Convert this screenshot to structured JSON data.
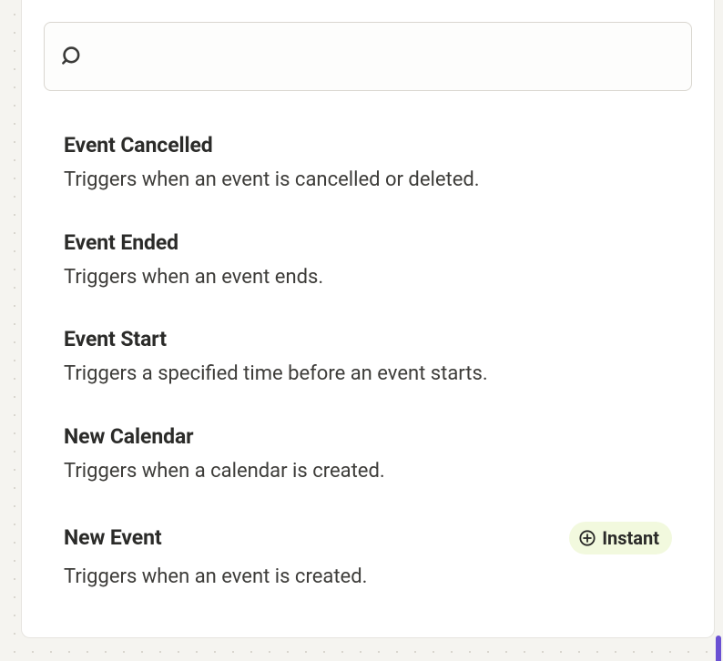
{
  "search": {
    "placeholder": ""
  },
  "badge_label": "Instant",
  "triggers": [
    {
      "title": "Event Cancelled",
      "desc": "Triggers when an event is cancelled or deleted.",
      "instant": false
    },
    {
      "title": "Event Ended",
      "desc": "Triggers when an event ends.",
      "instant": false
    },
    {
      "title": "Event Start",
      "desc": "Triggers a specified time before an event starts.",
      "instant": false
    },
    {
      "title": "New Calendar",
      "desc": "Triggers when a calendar is created.",
      "instant": false
    },
    {
      "title": "New Event",
      "desc": "Triggers when an event is created.",
      "instant": true
    }
  ]
}
